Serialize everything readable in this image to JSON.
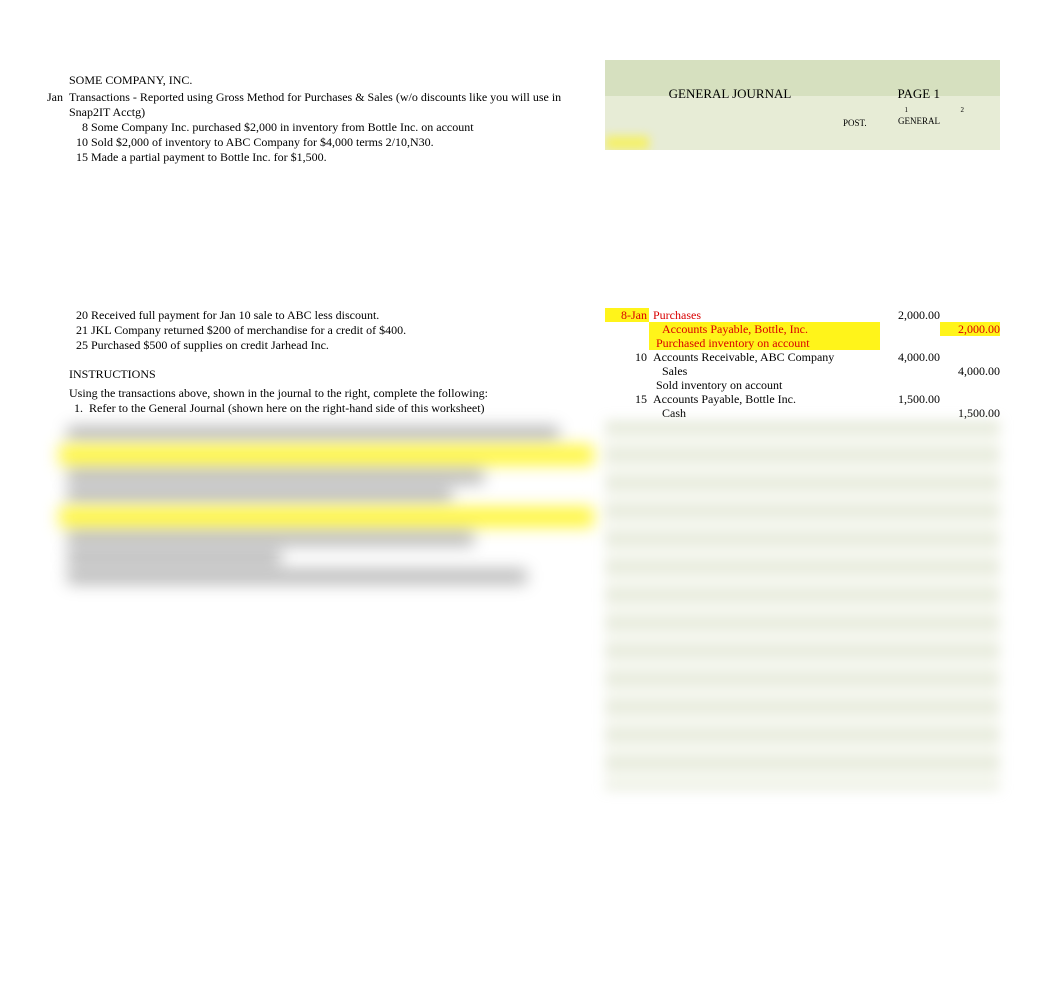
{
  "company": "SOME COMPANY, INC.",
  "tx_header": {
    "month": "Jan",
    "title": "Transactions - Reported using Gross Method for Purchases & Sales (w/o discounts like you will use in Snap2IT Acctg)"
  },
  "transactions_top": [
    {
      "day": "8",
      "text": "Some Company Inc. purchased $2,000 in inventory from Bottle Inc. on account"
    },
    {
      "day": "10",
      "text": "Sold $2,000 of inventory to ABC Company for $4,000 terms 2/10,N30."
    },
    {
      "day": "15",
      "text": "Made a partial payment to Bottle Inc. for $1,500."
    }
  ],
  "transactions_bottom": [
    {
      "day": "20",
      "text": "Received full payment for Jan 10 sale to ABC less discount."
    },
    {
      "day": "21",
      "text": "JKL Company returned $200 of merchandise for a credit of $400."
    },
    {
      "day": "25",
      "text": "Purchased $500 of supplies on credit Jarhead Inc."
    }
  ],
  "instructions": {
    "head": "INSTRUCTIONS",
    "line1": "Using the transactions above, shown in the journal to the right, complete the following:",
    "step1num": "1.",
    "step1": "Refer to the General Journal (shown here on the right-hand side of this worksheet)"
  },
  "gj": {
    "title": "GENERAL JOURNAL",
    "page": "PAGE 1",
    "post": "POST.",
    "general": "GENERAL",
    "n1": "1",
    "n2": "2"
  },
  "journal_rows": [
    {
      "date": "8-Jan",
      "desc": "Purchases",
      "dr": "2,000.00",
      "cr": "",
      "red": true,
      "hl_date": true
    },
    {
      "date": "",
      "desc": "Accounts Payable, Bottle, Inc.",
      "dr": "",
      "cr": "2,000.00",
      "red": true,
      "indent": 1,
      "hl_desc": true,
      "hl_cr": true
    },
    {
      "date": "",
      "desc": "Purchased inventory on account",
      "dr": "",
      "cr": "",
      "red": true,
      "indent": 2,
      "hl_desc": true
    },
    {
      "date": "10",
      "desc": "Accounts Receivable, ABC Company",
      "dr": "4,000.00",
      "cr": ""
    },
    {
      "date": "",
      "desc": "Sales",
      "dr": "",
      "cr": "4,000.00",
      "indent": 1
    },
    {
      "date": "",
      "desc": "Sold inventory on account",
      "dr": "",
      "cr": "",
      "indent": 2
    },
    {
      "date": "15",
      "desc": "Accounts Payable, Bottle Inc.",
      "dr": "1,500.00",
      "cr": ""
    },
    {
      "date": "",
      "desc": "Cash",
      "dr": "",
      "cr": "1,500.00",
      "indent": 1
    }
  ]
}
